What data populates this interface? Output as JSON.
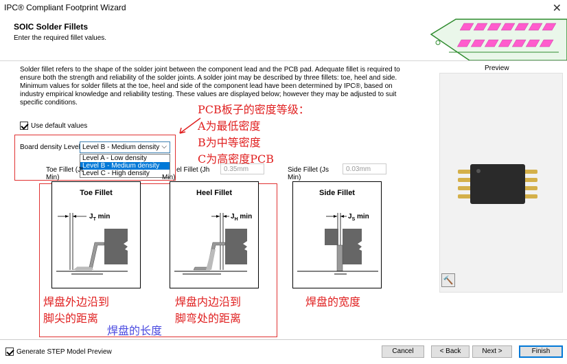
{
  "window": {
    "title": "IPC® Compliant Footprint Wizard"
  },
  "header": {
    "title": "SOIC Solder Fillets",
    "subtitle": "Enter the required fillet values."
  },
  "description": "Solder fillet refers to the shape of the solder joint between the component lead and the PCB pad. Adequate fillet is required to ensure both the strength and reliability of the solder joints. A solder joint may be described by three fillets: toe, heel and side. Minimum values for solder fillets at the toe, heel and side of the component lead have been determined by IPC®, based on industry empirical knowledge and reliability testing. These values are displayed below; however they may be adjusted to suit specific conditions.",
  "use_default": {
    "label": "Use default values",
    "checked": true
  },
  "density": {
    "label": "Board density Level",
    "selected": "Level B - Medium density",
    "options": [
      "Level A - Low density",
      "Level B - Medium density",
      "Level C - High density"
    ],
    "selected_index": 1
  },
  "fields": {
    "toe": {
      "label_line1": "Toe Fillet (Jt",
      "label_line2": "Min)"
    },
    "heel": {
      "label_line1": "el Fillet (Jh",
      "label_line2": "Min)",
      "value": "0.35mm"
    },
    "side": {
      "label_line1": "Side Fillet (Js",
      "label_line2": "Min)",
      "value": "0.03mm"
    }
  },
  "diagrams": {
    "toe": {
      "title": "Toe Fillet",
      "sym": "J",
      "sub": "T",
      "suffix": " min"
    },
    "heel": {
      "title": "Heel Fillet",
      "sym": "J",
      "sub": "H",
      "suffix": " min"
    },
    "side": {
      "title": "Side Fillet",
      "sym": "J",
      "sub": "S",
      "suffix": " min"
    }
  },
  "annotations": {
    "density_notes": [
      "PCB板子的密度等级：",
      "A为最低密度",
      "B为中等密度",
      "C为高密度PCB"
    ],
    "toe_note": [
      "焊盘外边沿到",
      "脚尖的距离"
    ],
    "heel_note": [
      "焊盘内边沿到",
      "脚弯处的距离"
    ],
    "length_note": "焊盘的长度",
    "side_note": "焊盘的宽度"
  },
  "preview": {
    "label": "Preview"
  },
  "footer": {
    "step_label": "Generate STEP Model Preview",
    "step_checked": true,
    "cancel": "Cancel",
    "back": "< Back",
    "next": "Next >",
    "finish": "Finish"
  },
  "colors": {
    "accent": "#0078d7",
    "annotation_red": "#e02020",
    "annotation_blue": "#4a4ae0",
    "pcb_green": "#2e8b2e",
    "pad_magenta": "#ff5ccd",
    "chip_body": "#2a2a2a",
    "pin_gold": "#d4b04a"
  }
}
